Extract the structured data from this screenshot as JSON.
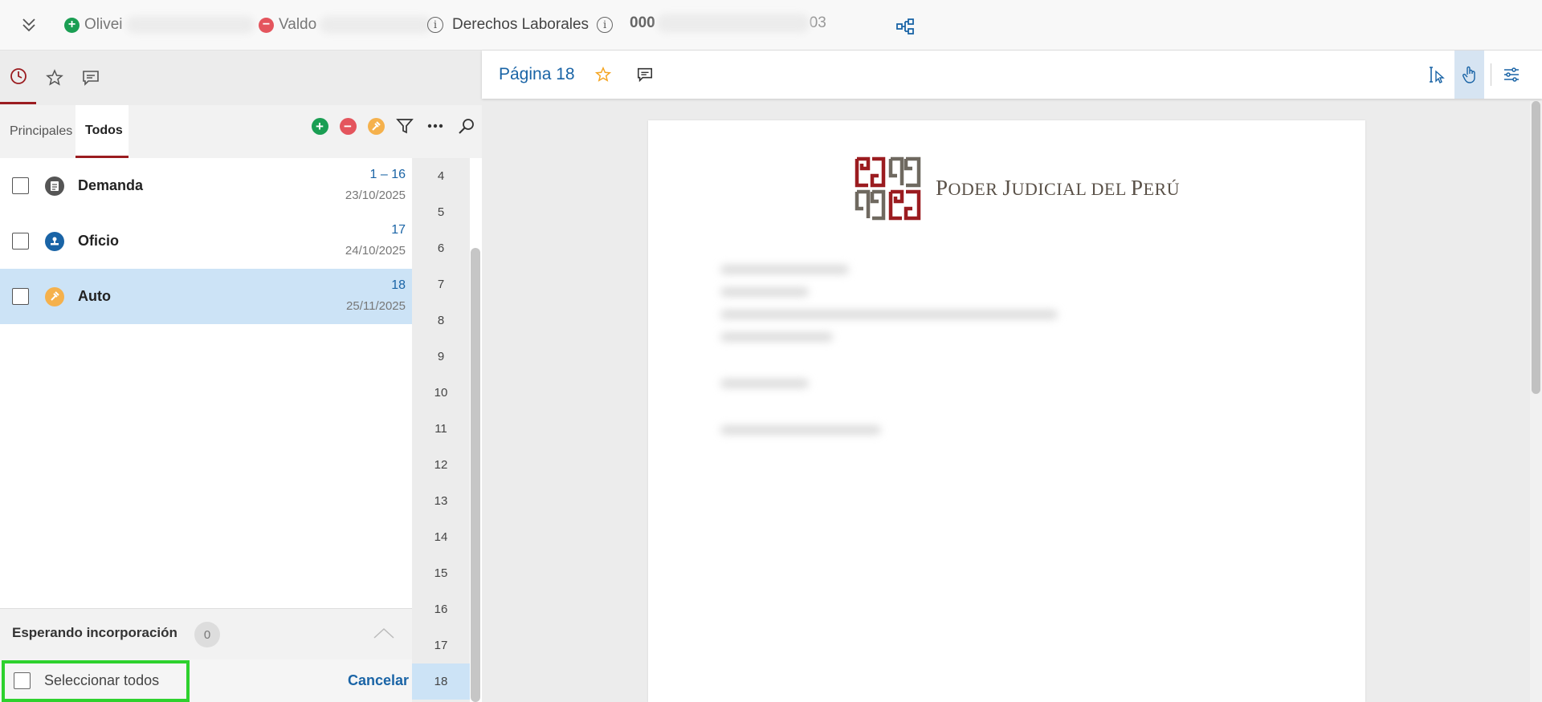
{
  "topbar": {
    "party1": "Olivei",
    "party2": "Valdo",
    "subject": "Derechos Laborales",
    "case_number_prefix": "000",
    "case_number_suffix": "03"
  },
  "left_tabs": [
    "history-icon",
    "star-icon",
    "comment-icon"
  ],
  "sub_tabs": {
    "principales": "Principales",
    "todos": "Todos"
  },
  "documents": [
    {
      "name": "Demanda",
      "pages": "1 – 16",
      "date": "23/10/2025",
      "icon": "document-icon",
      "icon_color": "#555555"
    },
    {
      "name": "Oficio",
      "pages": "17",
      "date": "24/10/2025",
      "icon": "stamp-icon",
      "icon_color": "#1a64a6"
    },
    {
      "name": "Auto",
      "pages": "18",
      "date": "25/11/2025",
      "icon": "gavel-icon",
      "icon_color": "#f5b14c",
      "selected": true
    }
  ],
  "page_numbers": [
    "4",
    "5",
    "6",
    "7",
    "8",
    "9",
    "10",
    "11",
    "12",
    "13",
    "14",
    "15",
    "16",
    "17",
    "18"
  ],
  "active_page": "18",
  "waiting": {
    "title": "Esperando incorporación",
    "count": "0"
  },
  "selection": {
    "select_all": "Seleccionar todos",
    "cancel": "Cancelar"
  },
  "viewer": {
    "page_label": "Página 18",
    "logo_text_p": "P",
    "logo_text_1": "ODER ",
    "logo_text_j": "J",
    "logo_text_2": "UDICIAL DEL ",
    "logo_text_p2": "P",
    "logo_text_3": "ERÚ"
  },
  "colors": {
    "accent": "#9b1c20",
    "link": "#1a64a6",
    "highlight": "#2ed12e",
    "selected_row": "#cce3f6"
  }
}
